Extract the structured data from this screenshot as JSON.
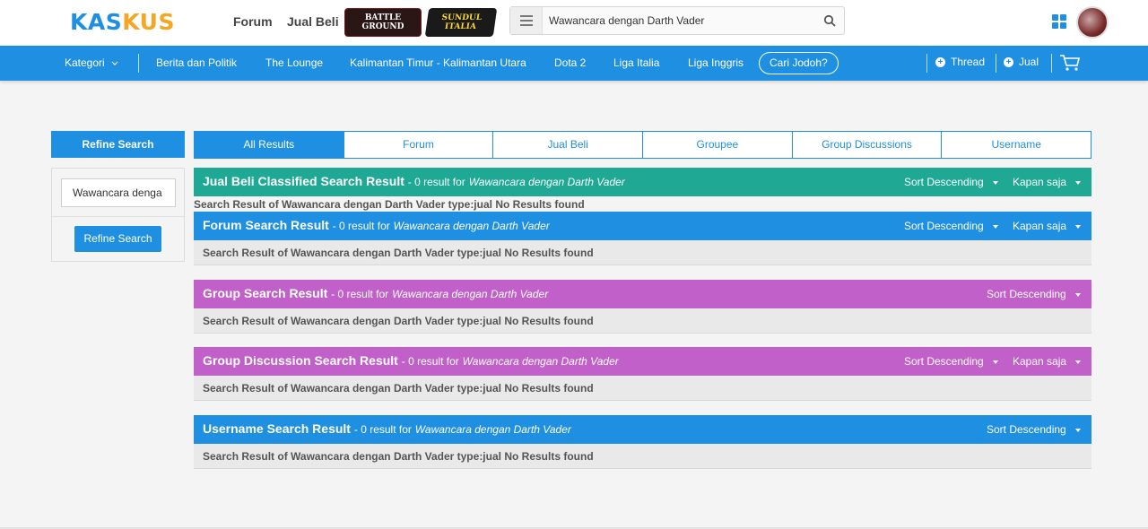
{
  "topbar": {
    "logo_left": "KAS",
    "logo_right": "KUS",
    "links": [
      "Forum",
      "Jual Beli"
    ],
    "promo_battle": "BATTLE GROUND",
    "promo_sundul": "SUNDUL ITALIA",
    "search_value": "Wawancara dengan Darth Vader"
  },
  "nav": {
    "kategori": "Kategori",
    "items": [
      "Berita dan Politik",
      "The Lounge",
      "Kalimantan Timur - Kalimantan Utara",
      "Dota 2",
      "Liga Italia",
      "Liga Inggris"
    ],
    "cari_jodoh": "Cari Jodoh?",
    "thread": "Thread",
    "jual": "Jual"
  },
  "refine": {
    "header": "Refine Search",
    "input_value": "Wawancara denga",
    "button": "Refine Search"
  },
  "tabs": [
    "All Results",
    "Forum",
    "Jual Beli",
    "Groupee",
    "Group Discussions",
    "Username"
  ],
  "query": "Wawancara dengan Darth Vader",
  "result_count_text": "- 0 result for",
  "sort_label": "Sort Descending",
  "time_label": "Kapan saja",
  "no_results": "Search Result of Wawancara dengan Darth Vader type:jual No Results found",
  "sections": [
    {
      "title": "Jual Beli Classified Search Result",
      "color": "#1fa894"
    },
    {
      "title": "Forum Search Result",
      "color": "#1e8fe1"
    },
    {
      "title": "Group Search Result",
      "color": "#c260c9"
    },
    {
      "title": "Group Discussion Search Result",
      "color": "#c260c9"
    },
    {
      "title": "Username Search Result",
      "color": "#1e8fe1"
    }
  ]
}
